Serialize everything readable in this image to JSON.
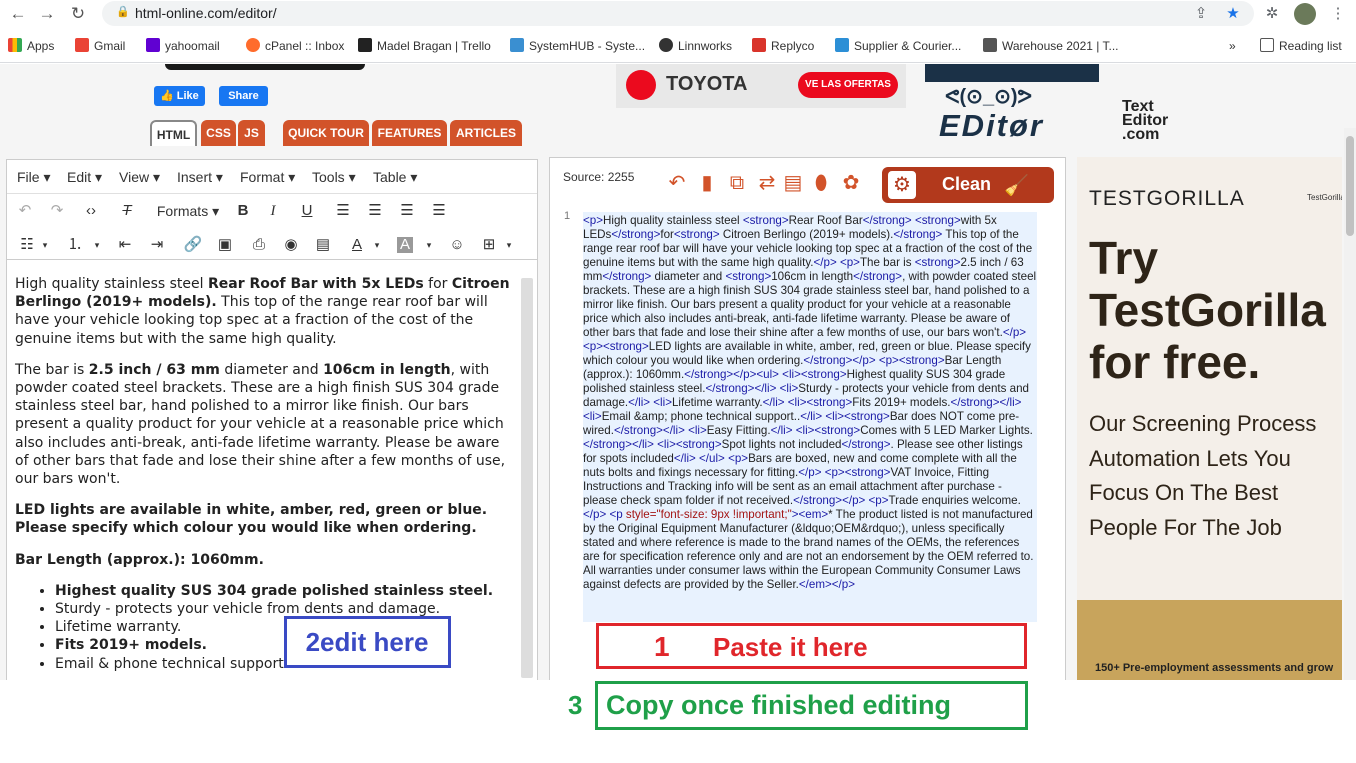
{
  "browser": {
    "url": "html-online.com/editor/",
    "bookmarks": [
      "Apps",
      "Gmail",
      "yahoomail",
      "cPanel :: Inbox",
      "Madel Bragan | Trello",
      "SystemHUB - Syste...",
      "Linnworks",
      "Replyco",
      "Supplier & Courier...",
      "Warehouse 2021 | T..."
    ],
    "reading_list": "Reading list",
    "more_bookmarks": "»"
  },
  "social": {
    "like": "Like",
    "share": "Share"
  },
  "site_tabs": [
    "HTML",
    "CSS",
    "JS",
    "QUICK TOUR",
    "FEATURES",
    "ARTICLES"
  ],
  "top_ad": {
    "brand": "TOYOTA",
    "cta": "VE LAS OFERTAS"
  },
  "site_logo": {
    "face": "ᕙ(⊙_⊙)ᕗ",
    "word": "EDitør",
    "text_editor_1": "Text",
    "text_editor_2": "Editor",
    "text_editor_3": ".com"
  },
  "editor": {
    "menus": [
      "File",
      "Edit",
      "View",
      "Insert",
      "Format",
      "Tools",
      "Table"
    ],
    "formats_label": "Formats",
    "content": {
      "p1_a": "High quality stainless steel ",
      "p1_b": "Rear Roof Bar with 5x LEDs",
      "p1_c": " for ",
      "p1_d": "Citroen Berlingo (2019+ models).",
      "p1_e": " This top of the range rear roof bar will have your vehicle looking top spec at a fraction of the cost of the genuine items but with the same high quality.",
      "p2_a": "The bar is ",
      "p2_b": "2.5 inch / 63 mm",
      "p2_c": " diameter and ",
      "p2_d": "106cm in length",
      "p2_e": ", with powder coated steel brackets. These are a high finish SUS 304 grade stainless steel bar, hand polished to a mirror like finish. Our bars present a quality product for your vehicle at a reasonable price which also includes anti-break, anti-fade lifetime warranty. Please be aware of other bars that fade and lose their shine after a few months of use, our bars won't.",
      "p3": "LED lights are available in white, amber, red, green or blue. Please specify which colour you would like when ordering.",
      "p4": "Bar Length (approx.): 1060mm.",
      "list": [
        "Highest quality SUS 304 grade polished stainless steel.",
        "Sturdy - protects your vehicle from dents and damage.",
        "Lifetime warranty.",
        "Fits 2019+ models.",
        "Email & phone technical support.."
      ]
    }
  },
  "source_panel": {
    "label": "Source: 2255",
    "clean_label": "Clean",
    "line_number": "1"
  },
  "annotations": {
    "a1_num": "1",
    "a1_text": "Paste it here",
    "a2_num": "2",
    "a2_text": "edit here",
    "a3_num": "3",
    "a3_text": "Copy once finished editing"
  },
  "right_ad": {
    "brand": "TESTGORILLA",
    "mini": "TestGorilla",
    "headline_1": "Try",
    "headline_2": "TestGorilla",
    "headline_3": "for free.",
    "sub": "Our Screening Process Automation Lets You Focus On The Best People For The Job",
    "band_text": "150+ Pre-employment assessments and grow"
  }
}
